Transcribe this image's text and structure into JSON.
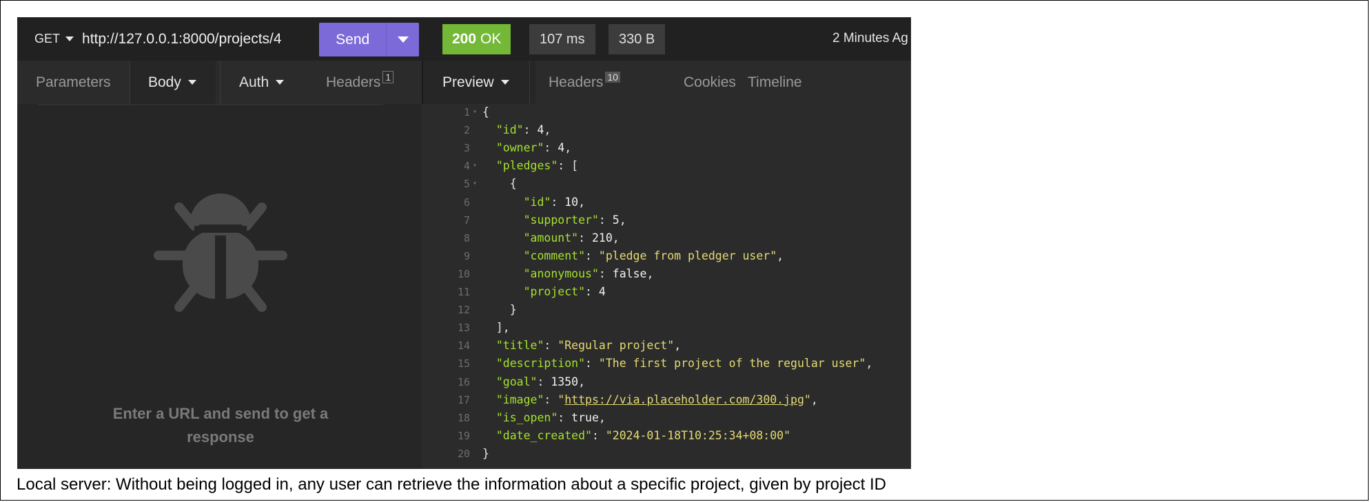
{
  "request": {
    "method": "GET",
    "url": "http://127.0.0.1:8000/projects/4",
    "send_label": "Send"
  },
  "response": {
    "status_code": "200",
    "status_text": "OK",
    "time": "107 ms",
    "size": "330 B",
    "ago": "2 Minutes Ag"
  },
  "request_tabs": [
    {
      "label": "Parameters"
    },
    {
      "label": "Body"
    },
    {
      "label": "Auth"
    },
    {
      "label": "Headers",
      "badge": "1"
    }
  ],
  "response_tabs": [
    {
      "label": "Preview"
    },
    {
      "label": "Headers",
      "badge": "10"
    },
    {
      "label": "Cookies"
    },
    {
      "label": "Timeline"
    }
  ],
  "empty_message": "Enter a URL and send to get a response",
  "json_lines": [
    {
      "n": "1",
      "fold": true,
      "parts": [
        [
          "p",
          "{"
        ]
      ]
    },
    {
      "n": "2",
      "parts": [
        [
          "p",
          "  "
        ],
        [
          "k",
          "\"id\""
        ],
        [
          "p",
          ": "
        ],
        [
          "n",
          "4"
        ],
        [
          "p",
          ","
        ]
      ]
    },
    {
      "n": "3",
      "parts": [
        [
          "p",
          "  "
        ],
        [
          "k",
          "\"owner\""
        ],
        [
          "p",
          ": "
        ],
        [
          "n",
          "4"
        ],
        [
          "p",
          ","
        ]
      ]
    },
    {
      "n": "4",
      "fold": true,
      "parts": [
        [
          "p",
          "  "
        ],
        [
          "k",
          "\"pledges\""
        ],
        [
          "p",
          ": ["
        ]
      ]
    },
    {
      "n": "5",
      "fold": true,
      "parts": [
        [
          "p",
          "    {"
        ]
      ]
    },
    {
      "n": "6",
      "parts": [
        [
          "p",
          "      "
        ],
        [
          "k",
          "\"id\""
        ],
        [
          "p",
          ": "
        ],
        [
          "n",
          "10"
        ],
        [
          "p",
          ","
        ]
      ]
    },
    {
      "n": "7",
      "parts": [
        [
          "p",
          "      "
        ],
        [
          "k",
          "\"supporter\""
        ],
        [
          "p",
          ": "
        ],
        [
          "n",
          "5"
        ],
        [
          "p",
          ","
        ]
      ]
    },
    {
      "n": "8",
      "parts": [
        [
          "p",
          "      "
        ],
        [
          "k",
          "\"amount\""
        ],
        [
          "p",
          ": "
        ],
        [
          "n",
          "210"
        ],
        [
          "p",
          ","
        ]
      ]
    },
    {
      "n": "9",
      "parts": [
        [
          "p",
          "      "
        ],
        [
          "k",
          "\"comment\""
        ],
        [
          "p",
          ": "
        ],
        [
          "s",
          "\"pledge from pledger user\""
        ],
        [
          "p",
          ","
        ]
      ]
    },
    {
      "n": "10",
      "parts": [
        [
          "p",
          "      "
        ],
        [
          "k",
          "\"anonymous\""
        ],
        [
          "p",
          ": "
        ],
        [
          "n",
          "false"
        ],
        [
          "p",
          ","
        ]
      ]
    },
    {
      "n": "11",
      "parts": [
        [
          "p",
          "      "
        ],
        [
          "k",
          "\"project\""
        ],
        [
          "p",
          ": "
        ],
        [
          "n",
          "4"
        ]
      ]
    },
    {
      "n": "12",
      "parts": [
        [
          "p",
          "    }"
        ]
      ]
    },
    {
      "n": "13",
      "parts": [
        [
          "p",
          "  ],"
        ]
      ]
    },
    {
      "n": "14",
      "parts": [
        [
          "p",
          "  "
        ],
        [
          "k",
          "\"title\""
        ],
        [
          "p",
          ": "
        ],
        [
          "s",
          "\"Regular project\""
        ],
        [
          "p",
          ","
        ]
      ]
    },
    {
      "n": "15",
      "parts": [
        [
          "p",
          "  "
        ],
        [
          "k",
          "\"description\""
        ],
        [
          "p",
          ": "
        ],
        [
          "s",
          "\"The first project of the regular user\""
        ],
        [
          "p",
          ","
        ]
      ]
    },
    {
      "n": "16",
      "parts": [
        [
          "p",
          "  "
        ],
        [
          "k",
          "\"goal\""
        ],
        [
          "p",
          ": "
        ],
        [
          "n",
          "1350"
        ],
        [
          "p",
          ","
        ]
      ]
    },
    {
      "n": "17",
      "parts": [
        [
          "p",
          "  "
        ],
        [
          "k",
          "\"image\""
        ],
        [
          "p",
          ": "
        ],
        [
          "s",
          "\""
        ],
        [
          "u",
          "https://via.placeholder.com/300.jpg"
        ],
        [
          "s",
          "\""
        ],
        [
          "p",
          ","
        ]
      ]
    },
    {
      "n": "18",
      "parts": [
        [
          "p",
          "  "
        ],
        [
          "k",
          "\"is_open\""
        ],
        [
          "p",
          ": "
        ],
        [
          "n",
          "true"
        ],
        [
          "p",
          ","
        ]
      ]
    },
    {
      "n": "19",
      "parts": [
        [
          "p",
          "  "
        ],
        [
          "k",
          "\"date_created\""
        ],
        [
          "p",
          ": "
        ],
        [
          "s",
          "\"2024-01-18T10:25:34+08:00\""
        ]
      ]
    },
    {
      "n": "20",
      "parts": [
        [
          "p",
          "}"
        ]
      ]
    }
  ],
  "caption": "Local server: Without being logged in, any user can retrieve the information about a specific project, given by project ID",
  "colors": {
    "send": "#7c6ad8",
    "status_ok": "#73b836",
    "json_key": "#a6e22e",
    "json_string": "#e6db74"
  }
}
